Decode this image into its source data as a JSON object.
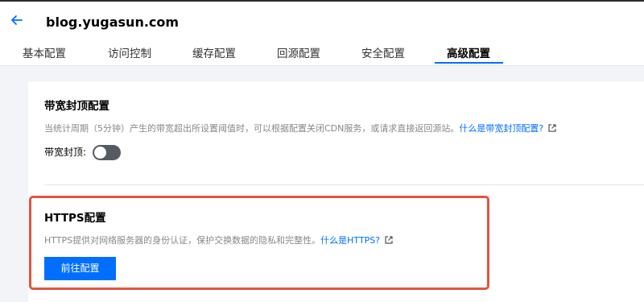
{
  "header": {
    "title": "blog.yugasun.com",
    "back_icon": "arrow-left-icon",
    "accent_color": "#006eff"
  },
  "tabs": [
    {
      "label": "基本配置",
      "active": false
    },
    {
      "label": "访问控制",
      "active": false
    },
    {
      "label": "缓存配置",
      "active": false
    },
    {
      "label": "回源配置",
      "active": false
    },
    {
      "label": "安全配置",
      "active": false
    },
    {
      "label": "高级配置",
      "active": true
    }
  ],
  "bandwidth": {
    "title": "带宽封顶配置",
    "description": "当统计周期（5分钟）产生的带宽超出所设置阈值时，可以根据配置关闭CDN服务，或请求直接返回源站。",
    "link_text": "什么是带宽封顶配置?",
    "toggle_label": "带宽封顶:",
    "toggle_on": false
  },
  "https": {
    "title": "HTTPS配置",
    "description": "HTTPS提供对网络服务器的身份认证，保护交换数据的隐私和完整性。",
    "link_text": "什么是HTTPS?",
    "button_label": "前往配置",
    "highlight_color": "#e2543e"
  }
}
